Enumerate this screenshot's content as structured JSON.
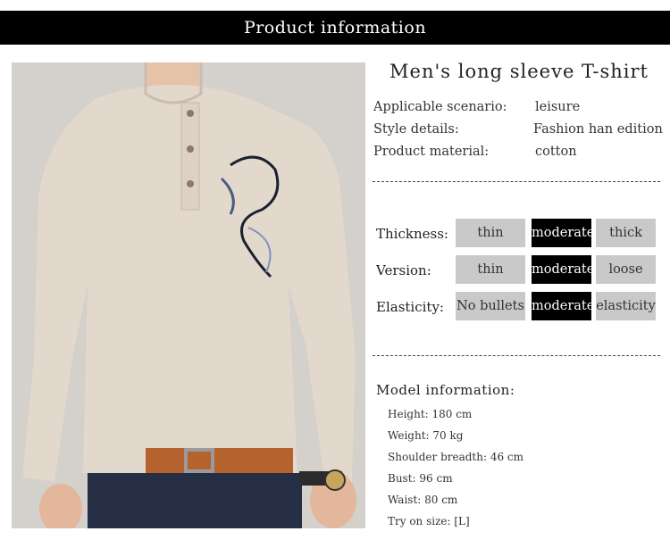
{
  "header": {
    "title": "Product information"
  },
  "product": {
    "title": "Men's long sleeve T-shirt"
  },
  "specs": [
    {
      "key": "Applicable scenario:",
      "value": "leisure"
    },
    {
      "key": "Style details:",
      "value": "Fashion han edition"
    },
    {
      "key": "Product material:",
      "value": "cotton"
    }
  ],
  "attributes": [
    {
      "label": "Thickness:",
      "options": [
        "thin",
        "moderate",
        "thick"
      ],
      "selected": 1
    },
    {
      "label": "Version:",
      "options": [
        "thin",
        "moderate",
        "loose"
      ],
      "selected": 1
    },
    {
      "label": "Elasticity:",
      "options": [
        "No bullets",
        "moderate",
        "elasticity"
      ],
      "selected": 1
    }
  ],
  "model": {
    "title": "Model information:",
    "items": [
      "Height: 180 cm",
      "Weight: 70 kg",
      "Shoulder breadth: 46 cm",
      "Bust: 96 cm",
      "Waist: 80 cm",
      "Try on size: [L]"
    ]
  },
  "colors": {
    "header_bg": "#000000",
    "selected_bg": "#000000",
    "option_bg": "#c9c9c9",
    "shirt": "#e2d8cc"
  }
}
